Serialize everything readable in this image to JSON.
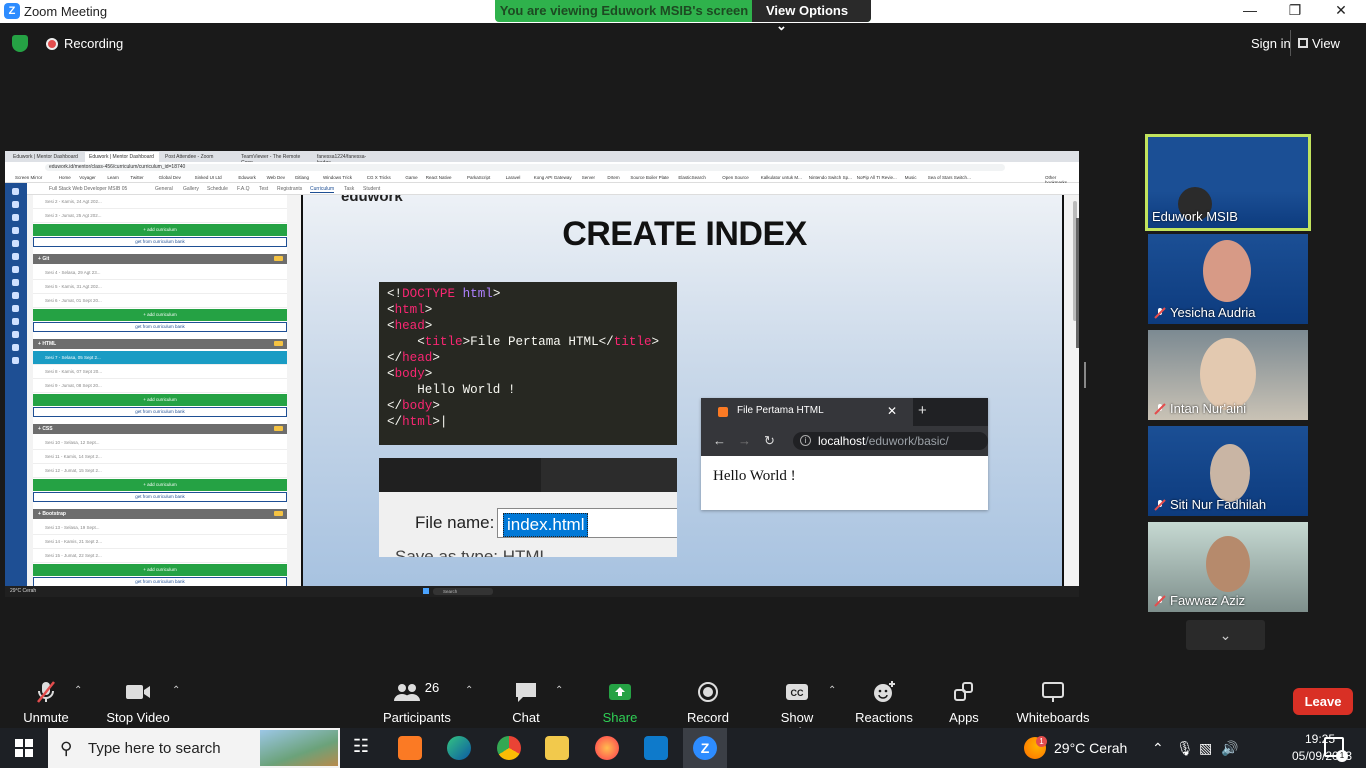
{
  "window": {
    "title": "Zoom Meeting"
  },
  "banner": {
    "viewing": "You are viewing Eduwork MSIB's screen",
    "view_options": "View Options"
  },
  "topbar": {
    "recording": "Recording",
    "sign_in": "Sign in",
    "view": "View"
  },
  "shared_screen": {
    "tabs": [
      "Eduwork | Mentor Dashboard",
      "Eduwork | Mentor Dashboard",
      "Post Attendee - Zoom",
      "TeamViewer - The Remote Conn...",
      "fanessa1224/fanessa-badge..."
    ],
    "url": "eduwork.id/mentor/class-456/curriculum/curriculum_id=18740",
    "bookmarks": [
      "Screen Mirror",
      "Home",
      "Voyager",
      "Learn",
      "Twitter",
      "Global Dev",
      "Sinked UI Ltd",
      "Eduwork",
      "Web Dev",
      "Gitlang",
      "Windows Trick",
      "CG X Tricks",
      "Game",
      "React Native",
      "ParkaScript",
      "Laravel",
      "Kong API Gateway",
      "Server",
      "Drtem",
      "Source Boiler Plate",
      "ElasticSearch",
      "Open Source",
      "Kalkulator untuk M...",
      "Nintendo Switch Sp...",
      "NoPip All TI Revie...",
      "Music",
      "Sea of Stars Switch...",
      "Other bookmarks"
    ],
    "course": "Full Stack Web Developer MSIB 05",
    "nav": [
      "General",
      "Gallery",
      "Schedule",
      "F.A.Q",
      "Test",
      "Registrants",
      "Curriculum",
      "Task",
      "Student"
    ],
    "curriculum": {
      "add_label": "+ add curriculum",
      "bank_label": "get from curriculum bank",
      "top_items": [
        "Sesi 2 - Kamis, 24 Agt 202...",
        "Sesi 3 - Jumat, 25 Agt 202..."
      ],
      "sections": [
        {
          "title": "Git",
          "items": [
            "Sesi 4 - Selasa, 29 Agt 23...",
            "Sesi 5 - Kamis, 31 Agt 202...",
            "Sesi 6 - Jumat, 01 Sept 20..."
          ]
        },
        {
          "title": "HTML",
          "items": [
            "Sesi 7 - Selasa, 05 Sept 2...",
            "Sesi 8 - Kamis, 07 Sept 20...",
            "Sesi 9 - Jumat, 08 Sept 20..."
          ]
        },
        {
          "title": "CSS",
          "items": [
            "Sesi 10 - Selasa, 12 Sept...",
            "Sesi 11 - Kamis, 14 Sept 2...",
            "Sesi 12 - Jumat, 15 Sept 2..."
          ]
        },
        {
          "title": "Bootstrap",
          "items": [
            "Sesi 13 - Selasa, 19 Sept...",
            "Sesi 14 - Kamis, 21 Sept 2...",
            "Sesi 15 - Jumat, 22 Sept 2..."
          ]
        }
      ]
    },
    "slide": {
      "logo": "eduwork",
      "title": "CREATE INDEX",
      "save_dialog": {
        "label": "File name:",
        "value": "index.html",
        "below": "Save as type:  HTML (*.html;*.htm;*.sht"
      },
      "browser": {
        "tab": "File Pertama HTML",
        "url_host": "localhost",
        "url_path": "/eduwork/basic/",
        "content": "Hello World !"
      }
    },
    "inner_taskbar": {
      "search": "Search",
      "weather": "29°C Cerah"
    }
  },
  "participants_gallery": [
    {
      "name": "Eduwork MSIB",
      "muted": false,
      "active": true
    },
    {
      "name": "Yesicha Audria",
      "muted": true,
      "active": false
    },
    {
      "name": "Intan Nur'aini",
      "muted": true,
      "active": false
    },
    {
      "name": "Siti Nur Fadhilah",
      "muted": true,
      "active": false
    },
    {
      "name": "Fawwaz Aziz",
      "muted": true,
      "active": false
    }
  ],
  "toolbar": {
    "unmute": "Unmute",
    "stop_video": "Stop Video",
    "participants": "Participants",
    "participants_count": "26",
    "chat": "Chat",
    "share_screen": "Share Screen",
    "record": "Record",
    "show_captions": "Show Captions",
    "reactions": "Reactions",
    "apps": "Apps",
    "whiteboards": "Whiteboards",
    "leave": "Leave"
  },
  "taskbar": {
    "search_placeholder": "Type here to search",
    "weather": "29°C  Cerah",
    "weather_badge": "1",
    "time": "19:25",
    "date": "05/09/2023",
    "notif_count": "1"
  },
  "colors": {
    "zoom_blue": "#2d8cff",
    "banner_green": "#2fb24c",
    "leave_red": "#d93025",
    "active_tile": "#c1e35e"
  }
}
